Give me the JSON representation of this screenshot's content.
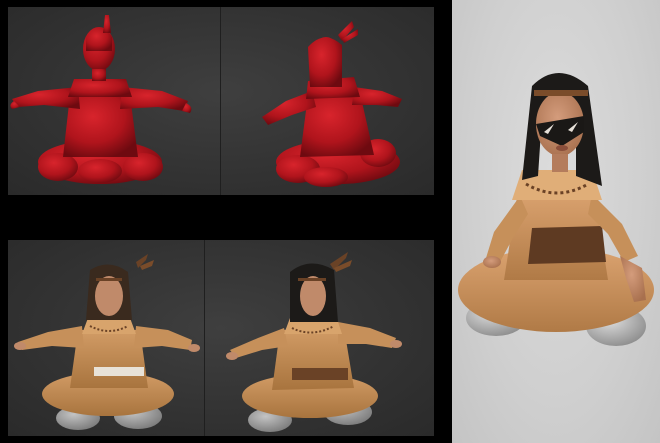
{
  "layout": {
    "background": "#000000",
    "panels": [
      "zbrush-sculpt-viewport",
      "textured-model-viewport",
      "final-render"
    ]
  },
  "colors": {
    "sculpt_red": "#b0141c",
    "sculpt_red_dark": "#7a0a10",
    "skin": "#c08a6a",
    "tunic": "#c6905a",
    "tunic_dark": "#9a6a3a",
    "belt": "#6a4226",
    "hair": "#1c1a18",
    "rock": "#9a9a9a",
    "viewport_bg": "#333333",
    "render_bg": "#d4d4d4"
  },
  "subjects": {
    "top_left": "red-sculpt-front",
    "top_right": "red-sculpt-three-quarter",
    "bottom_left": "textured-front-white-belt",
    "bottom_right": "textured-three-quarter-brown-belt",
    "render": "final-render-face-paint"
  }
}
